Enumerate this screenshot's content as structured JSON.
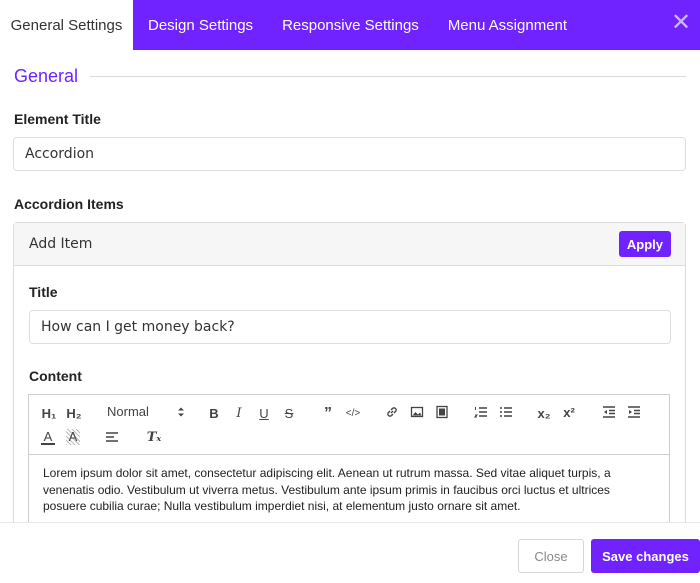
{
  "tabs": [
    {
      "label": "General Settings",
      "active": true
    },
    {
      "label": "Design Settings",
      "active": false
    },
    {
      "label": "Responsive Settings",
      "active": false
    },
    {
      "label": "Menu Assignment",
      "active": false
    }
  ],
  "close_glyph": "✕",
  "general": {
    "section_title": "General",
    "element_title_label": "Element Title",
    "element_title_value": "Accordion",
    "accordion_items_label": "Accordion Items"
  },
  "accordion": {
    "header_label": "Add Item",
    "apply_label": "Apply",
    "title_label": "Title",
    "title_value": "How can I get money back?",
    "content_label": "Content"
  },
  "editor": {
    "toolbar": {
      "h1": "H₁",
      "h2": "H₂",
      "format": "Normal",
      "bold": "B",
      "italic": "I",
      "underline": "U",
      "strike": "S",
      "quote": "”",
      "code": "</>",
      "subscript": "x₂",
      "superscript": "x²",
      "color": "A",
      "background": "A",
      "clear": "Tₓ"
    },
    "content": "Lorem ipsum dolor sit amet, consectetur adipiscing elit. Aenean ut rutrum massa. Sed vitae aliquet turpis, a venenatis odio. Vestibulum ut viverra metus. Vestibulum ante ipsum primis in faucibus orci luctus et ultrices posuere cubilia curae; Nulla vestibulum imperdiet nisi, at elementum justo ornare sit amet."
  },
  "footer": {
    "close_label": "Close",
    "save_label": "Save changes"
  },
  "colors": {
    "accent": "#7022ff"
  }
}
